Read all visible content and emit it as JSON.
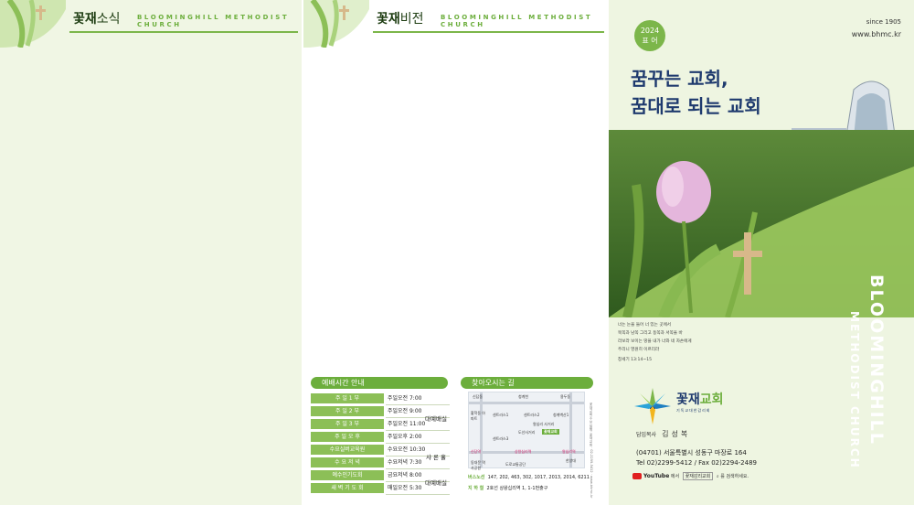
{
  "panel1": {
    "title_bold": "꽃재",
    "title_rest": "소식",
    "subtitle": "BLOOMINGHILL METHODIST CHURCH"
  },
  "panel2": {
    "title_bold": "꽃재",
    "title_rest": "비전",
    "subtitle": "BLOOMINGHILL METHODIST CHURCH",
    "schedule_title": "예배시간 안내",
    "schedule": [
      {
        "name": "주 일 1 부",
        "time": "주일오전 7:00"
      },
      {
        "name": "주 일 2 부",
        "time": "주일오전 9:00"
      },
      {
        "name": "주 일 3 부",
        "time": "주일오전 11:00"
      },
      {
        "name": "주 일 오 후",
        "time": "주일오후 2:00"
      },
      {
        "name": "수요실버교육원",
        "time": "수요오전 10:30"
      },
      {
        "name": "수 요 저 녁",
        "time": "수요저녁 7:30"
      },
      {
        "name": "예수인기도회",
        "time": "금요저녁 8:00"
      },
      {
        "name": "새 벽 기 도 회",
        "time": "매일오전 5:30"
      }
    ],
    "place_groups": [
      "대예배실",
      "샤 론 홀",
      "대예배실"
    ],
    "map_title": "찾아오시는 길",
    "map_labels": {
      "top_left": "신답동",
      "top_mid": "청계천",
      "top_right": "용두동",
      "hwang": "황학동 아파트",
      "center1": "센트라스1",
      "center2": "센트라스2",
      "center3": "센트라스3",
      "cheonggye": "청계벽산1",
      "wangsimni": "왕십리 사거리",
      "dosun": "도선사거리",
      "church": "꽃재교회",
      "metro_left": "신당역",
      "metro_mid": "상왕십리역",
      "metro_right": "왕십리역",
      "hanyang": "한양대",
      "dosun_rd": "도로교통공단",
      "bottom_left": "동대문 역사공원"
    },
    "bus_label": "버스노선",
    "bus_routes": "147, 202, 463, 302, 1017, 2013, 2014, 6211",
    "subway_label": "지 하 철",
    "subway_route": "2호선 상왕십리역 1, 1-1번출구",
    "side_note": "꽃재교회 주보 발행: 꽃재교회 · 02-2299-5412 · www.bhmc.kr"
  },
  "panel3": {
    "since": "since 1905",
    "url": "www.bhmc.kr",
    "badge_year": "2024",
    "badge_label": "표 어",
    "slogan1": "꿈꾸는 교회,",
    "slogan2": "꿈대로 되는 교회",
    "verse_lines": [
      "너는 눈을 들어 너 있는 곳에서",
      "북쪽과 남쪽 그리고 동쪽과 서쪽을 바",
      "라보라 보이는 땅을 내가 너와 네 자손에게",
      "주리니 영원히 이르리라"
    ],
    "verse_ref": "창세기 13:14~15",
    "vertical_name1": "BLOOMINGHILL",
    "vertical_name2": "METHODIST CHURCH",
    "logo_main": "꽃재",
    "logo_accent": "교회",
    "logo_sub": "기독교대한감리회",
    "pastor_label": "담임목사",
    "pastor_name": "김성복",
    "address": "(04701) 서울특별시 성동구 마장로 164",
    "tel": "Tel 02)2299-5412 / Fax 02)2294-2489",
    "yt_word": "YouTube",
    "yt_in": "에서",
    "yt_search": "꽃재감리교회",
    "yt_suffix": "를 검색하세요."
  },
  "colors": {
    "green": "#6cae3c",
    "navy": "#1e3a6e",
    "panel_bg": "#f0f6e4"
  }
}
